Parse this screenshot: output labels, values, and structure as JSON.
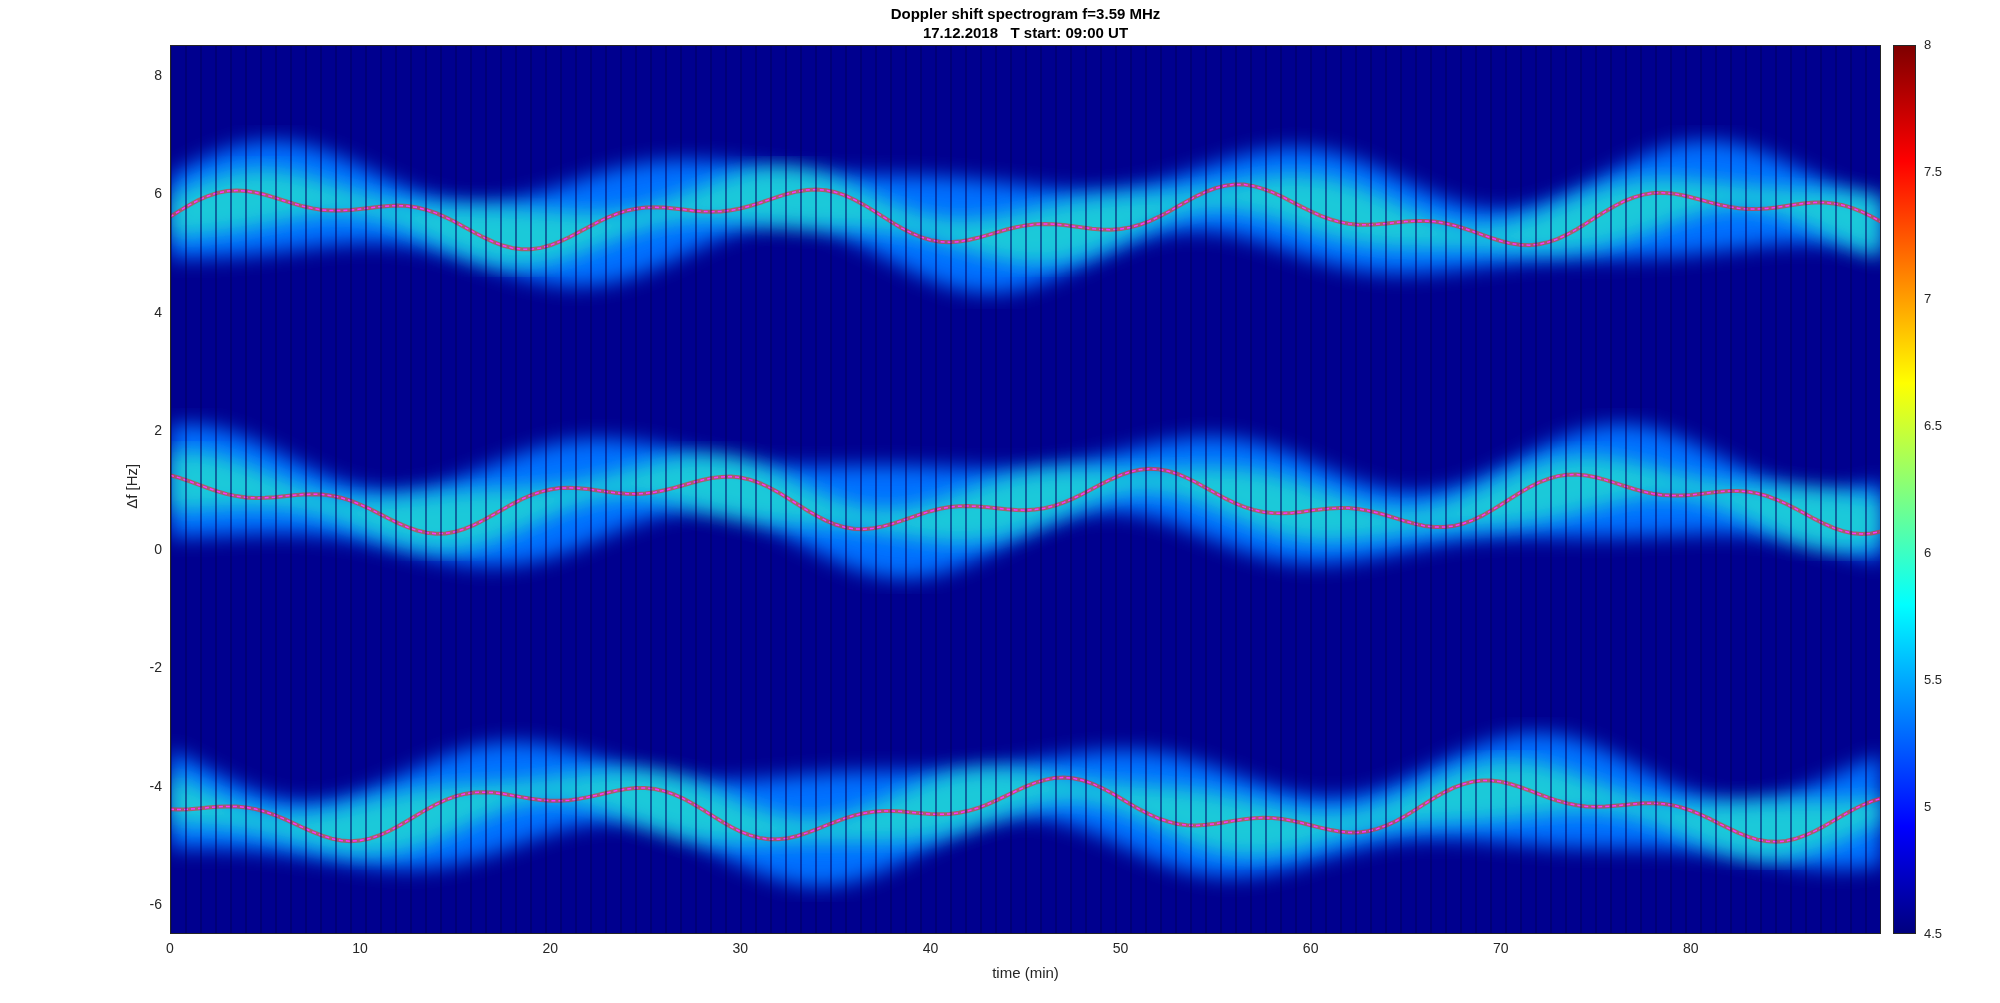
{
  "figure": {
    "title": "Doppler shift spectrogram f=3.59 MHz",
    "subtitle": "17.12.2018   T start: 09:00 UT"
  },
  "axes": {
    "ylabel": "Δf [Hz]",
    "xlabel": "time (min)",
    "yticks": [
      "8",
      "6",
      "4",
      "2",
      "0",
      "-2",
      "-4",
      "-6"
    ],
    "xticks": [
      "0",
      "10",
      "20",
      "30",
      "40",
      "50",
      "60",
      "70",
      "80"
    ]
  },
  "colorbar": {
    "ticks": [
      "8",
      "7.5",
      "7",
      "6.5",
      "6",
      "5.5",
      "5",
      "4.5"
    ]
  }
}
